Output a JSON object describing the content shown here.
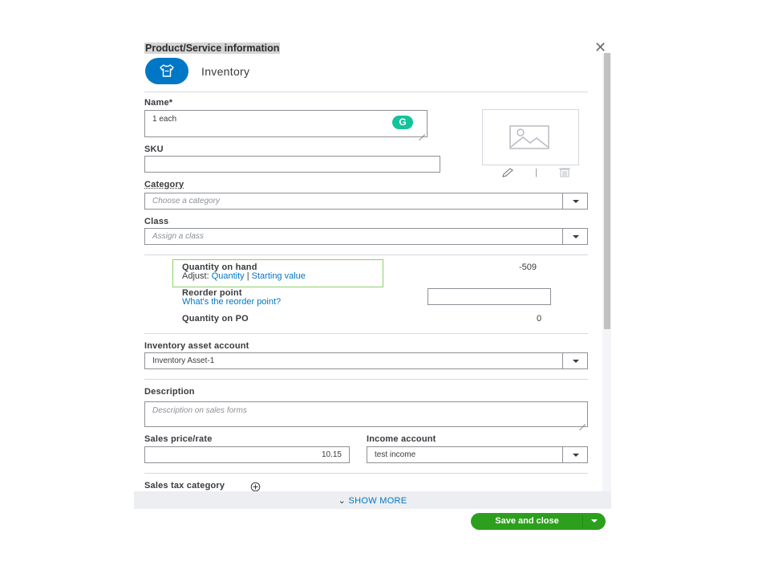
{
  "header": {
    "title": "Product/Service information",
    "close_icon": "close-icon"
  },
  "type": {
    "label": "Inventory",
    "icon": "shirt-icon",
    "color": "#0077c5"
  },
  "name": {
    "label": "Name*",
    "value": "1 each"
  },
  "sku": {
    "label": "SKU",
    "value": ""
  },
  "image": {
    "edit_icon": "pencil-icon",
    "delete_icon": "trash-icon"
  },
  "category": {
    "label": "Category",
    "placeholder": "Choose a category"
  },
  "class": {
    "label": "Class",
    "placeholder": "Assign a class"
  },
  "quantity": {
    "on_hand_label": "Quantity on hand",
    "adjust_prefix": "Adjust: ",
    "adjust_quantity_link": "Quantity",
    "separator": "|",
    "starting_value_link": "Starting value",
    "on_hand_value": "-509",
    "reorder_label": "Reorder point",
    "reorder_help_link": "What's the reorder point?",
    "reorder_value": "",
    "on_po_label": "Quantity on PO",
    "on_po_value": "0"
  },
  "inventory_asset": {
    "label": "Inventory asset account",
    "value": "Inventory Asset-1"
  },
  "description": {
    "label": "Description",
    "placeholder": "Description on sales forms"
  },
  "sales_price": {
    "label": "Sales price/rate",
    "value": "10.15"
  },
  "income_account": {
    "label": "Income account",
    "value": "test income"
  },
  "sales_tax": {
    "label": "Sales tax category",
    "icon": "plus-circle-icon"
  },
  "footer": {
    "show_more": "SHOW MORE",
    "save_label": "Save and close",
    "accent": "#2ca01c"
  }
}
